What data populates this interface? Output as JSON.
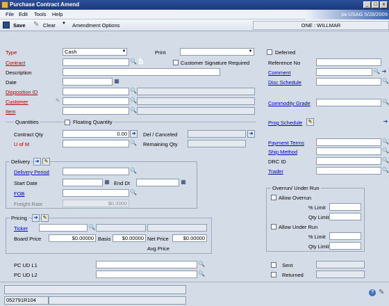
{
  "window": {
    "title": "Purchase Contract Amend",
    "user_info": "sa USAG 5/28/2009"
  },
  "menu": {
    "file": "File",
    "edit": "Edit",
    "tools": "Tools",
    "help": "Help"
  },
  "toolbar": {
    "save": "Save",
    "clear": "Clear",
    "amendment_options": "Amendment Options",
    "company": "ONE : WILLMAR"
  },
  "header": {
    "type_label": "Type",
    "type_value": "Cash",
    "print_label": "Print",
    "print_value": "",
    "contract_label": "Contract",
    "contract_value": "",
    "cust_sig_label": "Customer Signature Required",
    "description_label": "Description",
    "date_label": "Date",
    "disposition_label": "Disposition ID",
    "customer_label": "Customer",
    "item_label": "Item"
  },
  "quantities": {
    "group_label": "Quantities",
    "floating_label": "Floating Quantity",
    "contract_qty_label": "Contract Qty",
    "contract_qty_value": "0.00",
    "uom_label": "U of M",
    "del_canceled_label": "Del / Canceled",
    "remaining_qty_label": "Remaining Qty"
  },
  "delivery": {
    "group_label": "Delivery",
    "period_label": "Delivery Period",
    "start_date_label": "Start Date",
    "end_dt_label": "End Dt",
    "fob_label": "FOB",
    "freight_rate_label": "Freight Rate",
    "freight_rate_value": "$0.0000"
  },
  "pricing": {
    "group_label": "Pricing",
    "ticker_label": "Ticker",
    "board_price_label": "Board Price",
    "board_price_value": "$0.00000",
    "basis_label": "Basis",
    "basis_value": "$0.00000",
    "net_price_label": "Net Price",
    "net_price_value": "$0.00000",
    "avg_price_label": "Avg Price"
  },
  "pcud": {
    "l1_label": "PC UD L1",
    "l2_label": "PC UD L2"
  },
  "right": {
    "deferred_label": "Deferred",
    "reference_label": "Reference No",
    "comment_label": "Comment",
    "disc_schedule_label": "Disc Schedule",
    "commodity_grade_label": "Commodity Grade",
    "prog_schedule_label": "Prog Schedule",
    "payment_terms_label": "Payment Terms",
    "ship_method_label": "Ship Method",
    "drc_id_label": "DRC ID",
    "trader_label": "Trader"
  },
  "overrun": {
    "group_label": "Overrun/ Under Run",
    "allow_overrun_label": "Allow Overrun",
    "pct_limit_label": "% Limit",
    "qty_limit_label": "Qty Limit",
    "allow_underrun_label": "Allow Under Run",
    "pct_limit2_label": "% Limit",
    "qty_limit2_label": "Qty Limit"
  },
  "status": {
    "sent_label": "Sent",
    "returned_label": "Returned"
  },
  "footer": {
    "record_id": "052791R104"
  }
}
